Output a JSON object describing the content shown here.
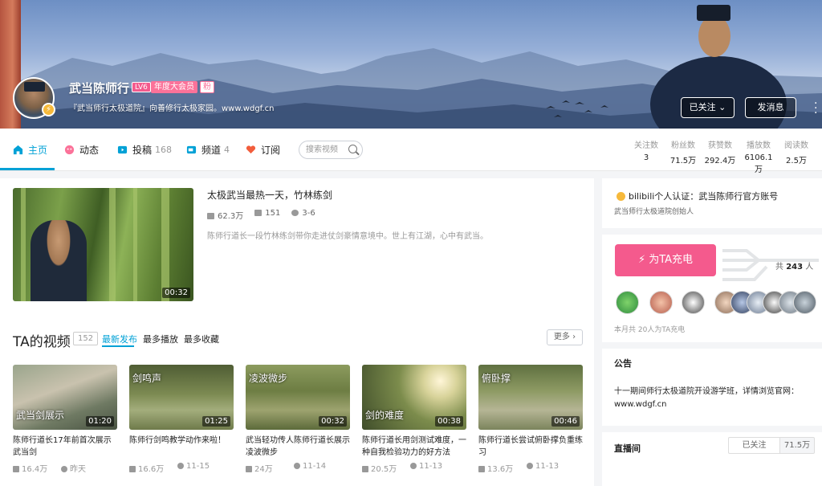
{
  "header": {
    "username": "武当陈师行",
    "level": "LV6",
    "vip": "年度大会员",
    "fan_badge": "粉",
    "sign": "『武当师行太极道院』向善修行太极家园。www.wdgf.cn",
    "follow_label": "已关注",
    "message_label": "发消息"
  },
  "nav": {
    "home": "主页",
    "dynamic": "动态",
    "submit": "投稿",
    "submit_count": "168",
    "channel": "频道",
    "channel_count": "4",
    "subscribe": "订阅",
    "search_placeholder": "搜索视频"
  },
  "stats": [
    {
      "label": "关注数",
      "value": "3"
    },
    {
      "label": "粉丝数",
      "value": "71.5万"
    },
    {
      "label": "获赞数",
      "value": "292.4万"
    },
    {
      "label": "播放数",
      "value": "6106.1万"
    },
    {
      "label": "阅读数",
      "value": "2.5万"
    }
  ],
  "featured": {
    "title": "太极武当最热一天，竹林练剑",
    "plays": "62.3万",
    "danmaku": "151",
    "date": "3-6",
    "desc": "陈师行道长一段竹林练剑带你走进仗剑豪情意境中。世上有江湖，心中有武当。",
    "duration": "00:32"
  },
  "videos_section": {
    "title": "TA的视频",
    "count": "152",
    "tabs": [
      "最新发布",
      "最多播放",
      "最多收藏"
    ],
    "more": "更多"
  },
  "videos": [
    {
      "title": "陈师行道长17年前首次展示武当剑",
      "plays": "16.4万",
      "date": "昨天",
      "duration": "01:20",
      "caption": "武当剑展示"
    },
    {
      "title": "陈师行剑鸣教学动作来啦！",
      "plays": "16.6万",
      "date": "11-15",
      "duration": "01:25",
      "caption": "剑鸣声"
    },
    {
      "title": "武当轻功传人陈师行道长展示凌波微步",
      "plays": "24万",
      "date": "11-14",
      "duration": "00:32",
      "caption": "凌波微步"
    },
    {
      "title": "陈师行道长用剑测试难度，一种自我检验功力的好方法",
      "plays": "20.5万",
      "date": "11-13",
      "duration": "00:38",
      "caption": "剑的难度"
    },
    {
      "title": "陈师行道长尝试俯卧撑负重练习",
      "plays": "13.6万",
      "date": "11-13",
      "duration": "00:46",
      "caption": "俯卧撑"
    }
  ],
  "cert": {
    "title": "bilibili个人认证：武当陈师行官方账号",
    "sub": "武当师行太极道院创始人"
  },
  "charge": {
    "button": "为TA充电",
    "total_prefix": "共",
    "total": "243",
    "total_suffix": "人",
    "month_text": "本月共 20人为TA充电"
  },
  "notice": {
    "heading": "公告",
    "text": "十一期间师行太极道院开设游学班，详情浏览官网：www.wdgf.cn"
  },
  "live": {
    "heading": "直播间",
    "followed": "已关注",
    "count": "71.5万"
  }
}
